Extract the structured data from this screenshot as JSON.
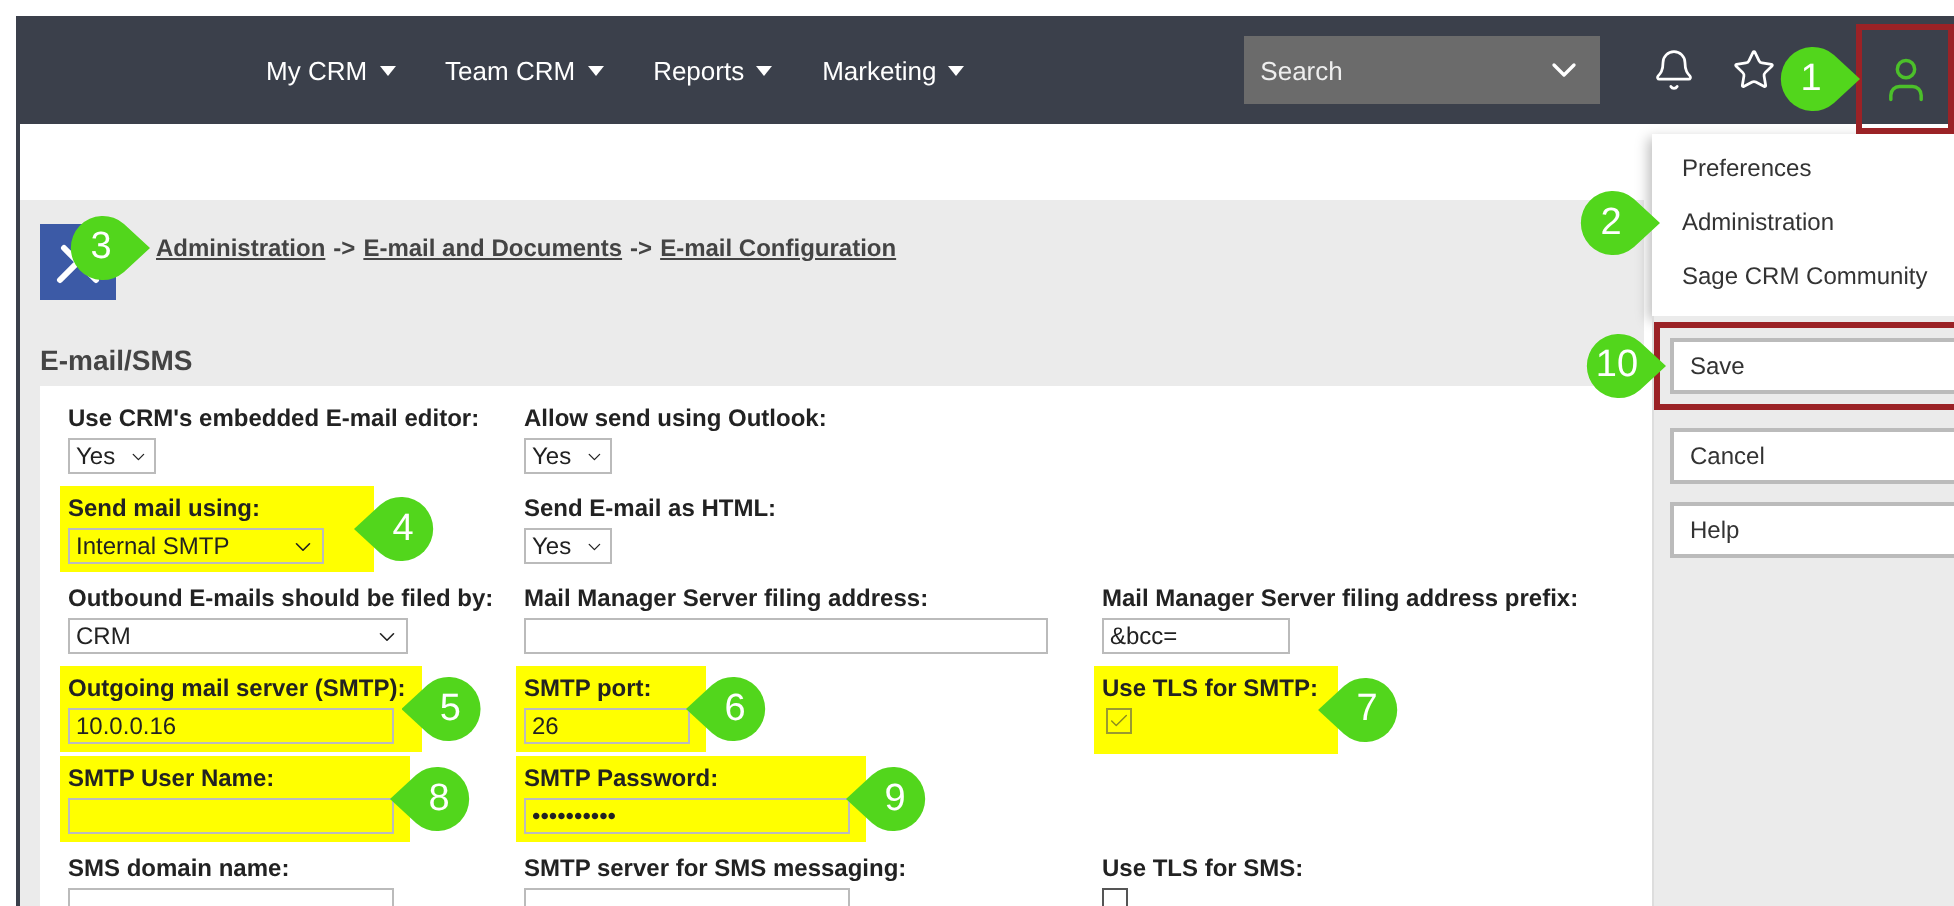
{
  "nav": {
    "menus": [
      {
        "label": "My CRM"
      },
      {
        "label": "Team CRM"
      },
      {
        "label": "Reports"
      },
      {
        "label": "Marketing"
      }
    ],
    "search": {
      "placeholder": "Search"
    },
    "user_button": {
      "outlined": true,
      "callout": {
        "number": "1",
        "points_left": false
      }
    }
  },
  "user_menu": {
    "items": [
      {
        "label": "Preferences"
      },
      {
        "label": "Administration",
        "callout": {
          "number": "2",
          "points_left": false
        }
      },
      {
        "label": "Sage CRM Community"
      }
    ]
  },
  "breadcrumb": {
    "callout": {
      "number": "3",
      "points_left": false
    },
    "parts": [
      {
        "kind": "link",
        "label": "Administration"
      },
      {
        "kind": "separator",
        "label": "->"
      },
      {
        "kind": "link",
        "label": "E-mail and Documents"
      },
      {
        "kind": "separator",
        "label": "->"
      },
      {
        "kind": "link",
        "label": "E-mail Configuration"
      }
    ]
  },
  "section": {
    "title": "E-mail/SMS"
  },
  "form": {
    "rows": [
      {
        "fields": [
          {
            "label": "Use CRM's embedded E-mail editor:",
            "kind": "select",
            "value": "Yes",
            "highlighted": false
          },
          {
            "label": "Allow send using Outlook:",
            "kind": "select",
            "value": "Yes",
            "highlighted": false
          }
        ]
      },
      {
        "fields": [
          {
            "label": "Send mail using:",
            "kind": "select",
            "value": "Internal SMTP",
            "highlighted": true,
            "callout": {
              "number": "4",
              "points_left": true
            }
          },
          {
            "label": "Send E-mail as HTML:",
            "kind": "select",
            "value": "Yes",
            "highlighted": false
          }
        ]
      },
      {
        "fields": [
          {
            "label": "Outbound E-mails should be filed by:",
            "kind": "select",
            "value": "CRM",
            "highlighted": false
          },
          {
            "label": "Mail Manager Server filing address:",
            "kind": "text",
            "highlighted": false
          },
          {
            "label": "Mail Manager Server filing address prefix:",
            "kind": "text",
            "value": "&bcc=",
            "highlighted": false
          }
        ]
      },
      {
        "fields": [
          {
            "label": "Outgoing mail server (SMTP):",
            "kind": "text",
            "value": "10.0.0.16",
            "highlighted": true,
            "callout": {
              "number": "5",
              "points_left": true
            }
          },
          {
            "label": "SMTP port:",
            "kind": "text",
            "value": "26",
            "highlighted": true,
            "callout": {
              "number": "6",
              "points_left": true
            }
          },
          {
            "label": "Use TLS for SMTP:",
            "kind": "checkbox",
            "checked": true,
            "highlighted": true,
            "callout": {
              "number": "7",
              "points_left": true
            }
          }
        ]
      },
      {
        "fields": [
          {
            "label": "SMTP User Name:",
            "kind": "text",
            "highlighted": true,
            "callout": {
              "number": "8",
              "points_left": true
            }
          },
          {
            "label": "SMTP Password:",
            "kind": "password",
            "value": "••••••••••",
            "highlighted": true,
            "callout": {
              "number": "9",
              "points_left": true
            }
          }
        ]
      },
      {
        "fields": [
          {
            "label": "SMS domain name:",
            "kind": "text",
            "highlighted": false
          },
          {
            "label": "SMTP server for SMS messaging:",
            "kind": "text",
            "highlighted": false
          },
          {
            "label": "Use TLS for SMS:",
            "kind": "checkbox",
            "checked": false,
            "highlighted": false
          }
        ]
      }
    ]
  },
  "actions": [
    {
      "label": "Save",
      "outlined": true,
      "callout": {
        "number": "10",
        "points_left": false
      }
    },
    {
      "label": "Cancel",
      "outlined": false
    },
    {
      "label": "Help",
      "outlined": false
    }
  ]
}
